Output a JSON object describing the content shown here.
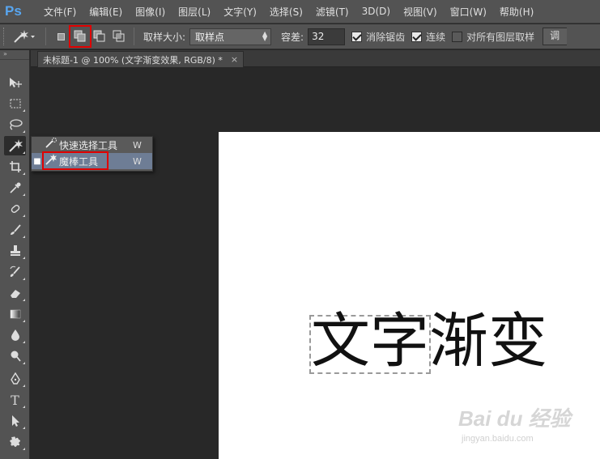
{
  "app": {
    "logo": "Ps"
  },
  "menu": [
    "文件(F)",
    "编辑(E)",
    "图像(I)",
    "图层(L)",
    "文字(Y)",
    "选择(S)",
    "滤镜(T)",
    "3D(D)",
    "视图(V)",
    "窗口(W)",
    "帮助(H)"
  ],
  "options": {
    "tool_preset_icon": "magic-wand-icon",
    "selection_modes": [
      {
        "name": "new-selection",
        "active": false
      },
      {
        "name": "add-to-selection",
        "active": true
      },
      {
        "name": "subtract-from-selection",
        "active": false
      },
      {
        "name": "intersect-with-selection",
        "active": false
      }
    ],
    "sample_size_label": "取样大小:",
    "sample_size_value": "取样点",
    "tolerance_label": "容差:",
    "tolerance_value": "32",
    "antialias_label": "消除锯齿",
    "antialias_checked": true,
    "contiguous_label": "连续",
    "contiguous_checked": true,
    "all_layers_label": "对所有图层取样",
    "all_layers_checked": false,
    "refine_label": "调"
  },
  "toolbar": {
    "collapse_glyph": "»",
    "tools": [
      "move-icon",
      "marquee-icon",
      "lasso-icon",
      "magic-wand-icon",
      "crop-icon",
      "eyedropper-icon",
      "healing-brush-icon",
      "brush-icon",
      "clone-stamp-icon",
      "history-brush-icon",
      "eraser-icon",
      "gradient-icon",
      "blur-icon",
      "dodge-icon",
      "pen-icon",
      "type-icon",
      "path-selection-icon",
      "shape-icon"
    ]
  },
  "document": {
    "tab_title": "未标题-1 @ 100% (文字渐变效果, RGB/8) *",
    "close_glyph": "×",
    "canvas_text_selected": "文字",
    "canvas_text_rest": "渐变"
  },
  "flyout": {
    "items": [
      {
        "label": "快速选择工具",
        "shortcut": "W",
        "icon": "quick-selection-icon",
        "current": false
      },
      {
        "label": "魔棒工具",
        "shortcut": "W",
        "icon": "magic-wand-icon",
        "current": true
      }
    ],
    "current_marker": "■"
  },
  "watermark": {
    "main": "Bai du 经验",
    "sub": "jingyan.baidu.com"
  },
  "colors": {
    "highlight_red": "#e00000",
    "menu_bg": "#535353",
    "workspace_bg": "#282828",
    "flyout_highlight": "#6e7d95"
  }
}
